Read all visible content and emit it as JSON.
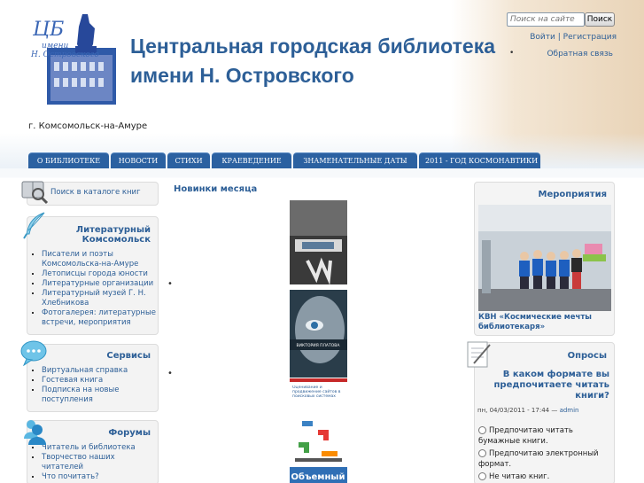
{
  "header": {
    "site_title": "Центральная городская библиотека имени Н. Островского",
    "slogan": "г. Комсомольск-на-Амуре",
    "logo_text_top": "ЦБ",
    "logo_text_mid": "имени",
    "logo_text_name": "Н. Островского"
  },
  "search": {
    "placeholder": "Поиск на сайте",
    "button_label": "Поиск"
  },
  "user_links": {
    "login": "Войти",
    "separator": " | ",
    "register": "Регистрация",
    "feedback": "Обратная связь"
  },
  "nav": {
    "tabs": [
      "О БИБЛИОТЕКЕ",
      "НОВОСТИ",
      "СТИХИ",
      "КРАЕВЕДЕНИЕ",
      "ЗНАМЕНАТЕЛЬНЫЕ ДАТЫ",
      "2011 - ГОД КОСМОНАВТИКИ"
    ]
  },
  "sidebar_left": {
    "catalog_link": "Поиск в каталоге книг",
    "literary": {
      "title_line1": "Литературный",
      "title_line2": "Комсомольск",
      "items": [
        "Писатели и поэты Комсомольска-на-Амуре",
        "Летописцы города юности",
        "Литературные организации",
        "Литературный музей Г. Н. Хлебникова",
        "Фотогалерея: литературные встречи, мероприятия"
      ]
    },
    "services": {
      "title": "Сервисы",
      "items": [
        "Виртуальная справка",
        "Гостевая книга",
        "Подписка на новые поступления"
      ]
    },
    "forums": {
      "title": "Форумы",
      "items": [
        "Читатель и библиотека",
        "Творчество наших читателей",
        "Что почитать?"
      ]
    }
  },
  "center": {
    "title": "Новинки месяца",
    "book2_text": "ВИКТОРИЯ ПЛАТОВА",
    "book3_text": "Оценивание и продвижение сайтов в поисковых системах",
    "book4_text": "Объемный"
  },
  "sidebar_right": {
    "events": {
      "title": "Мероприятия",
      "caption": "КВН «Космические мечты библиотекаря»"
    },
    "polls": {
      "title": "Опросы",
      "question": "В каком формате вы предпочитаете читать книги?",
      "meta_date": "пн, 04/03/2011 - 17:44",
      "meta_sep": " — ",
      "meta_author": "admin",
      "options": [
        "Предпочитаю читать бумажные книги.",
        "Предпочитаю электронный формат.",
        "Не читаю книг."
      ]
    }
  },
  "colors": {
    "brand_blue": "#2d5f97",
    "nav_blue": "#2b61a1"
  }
}
